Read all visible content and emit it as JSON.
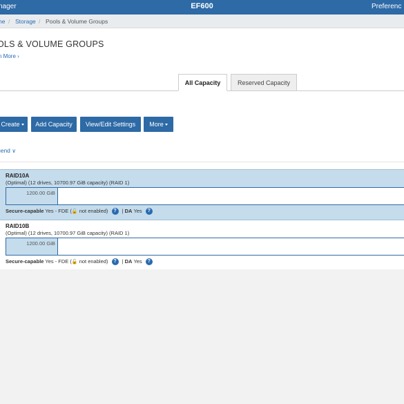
{
  "header": {
    "app_name": "nager",
    "system_name": "EF600",
    "preferences": "Preferenc"
  },
  "breadcrumb": {
    "home": "ne",
    "storage": "Storage",
    "current": "Pools & Volume Groups",
    "separator": "/"
  },
  "page": {
    "title": "OLS & VOLUME GROUPS",
    "learn_more": "n More ›"
  },
  "tabs": [
    {
      "label": "All Capacity",
      "active": true
    },
    {
      "label": "Reserved Capacity",
      "active": false
    }
  ],
  "toolbar": {
    "create": "Create",
    "add_capacity": "Add Capacity",
    "view_edit": "View/Edit Settings",
    "more": "More"
  },
  "legend": {
    "label": "gend",
    "chevron": "∨"
  },
  "pools": [
    {
      "name": "RAID10A",
      "description": "(Optimal) (12 drives, 10700.97 GiB capacity) (RAID 1)",
      "volume_size": "1200.00 GiB",
      "used_fraction": 0.13,
      "secure_label": "Secure-capable",
      "secure_value": "Yes - FDE (",
      "fde_status": "not enabled)",
      "da_label": "DA",
      "da_value": "Yes",
      "selected": true
    },
    {
      "name": "RAID10B",
      "description": "(Optimal) (12 drives, 10700.97 GiB capacity) (RAID 1)",
      "volume_size": "1200.00 GiB",
      "used_fraction": 0.13,
      "secure_label": "Secure-capable",
      "secure_value": "Yes - FDE (",
      "fde_status": "not enabled)",
      "da_label": "DA",
      "da_value": "Yes",
      "selected": false
    }
  ],
  "icons": {
    "help": "?",
    "lock": "🔓",
    "pipe": "|"
  },
  "colors": {
    "brand": "#2d6aa6",
    "selection": "#c5dcec",
    "link": "#2a6ab0"
  }
}
